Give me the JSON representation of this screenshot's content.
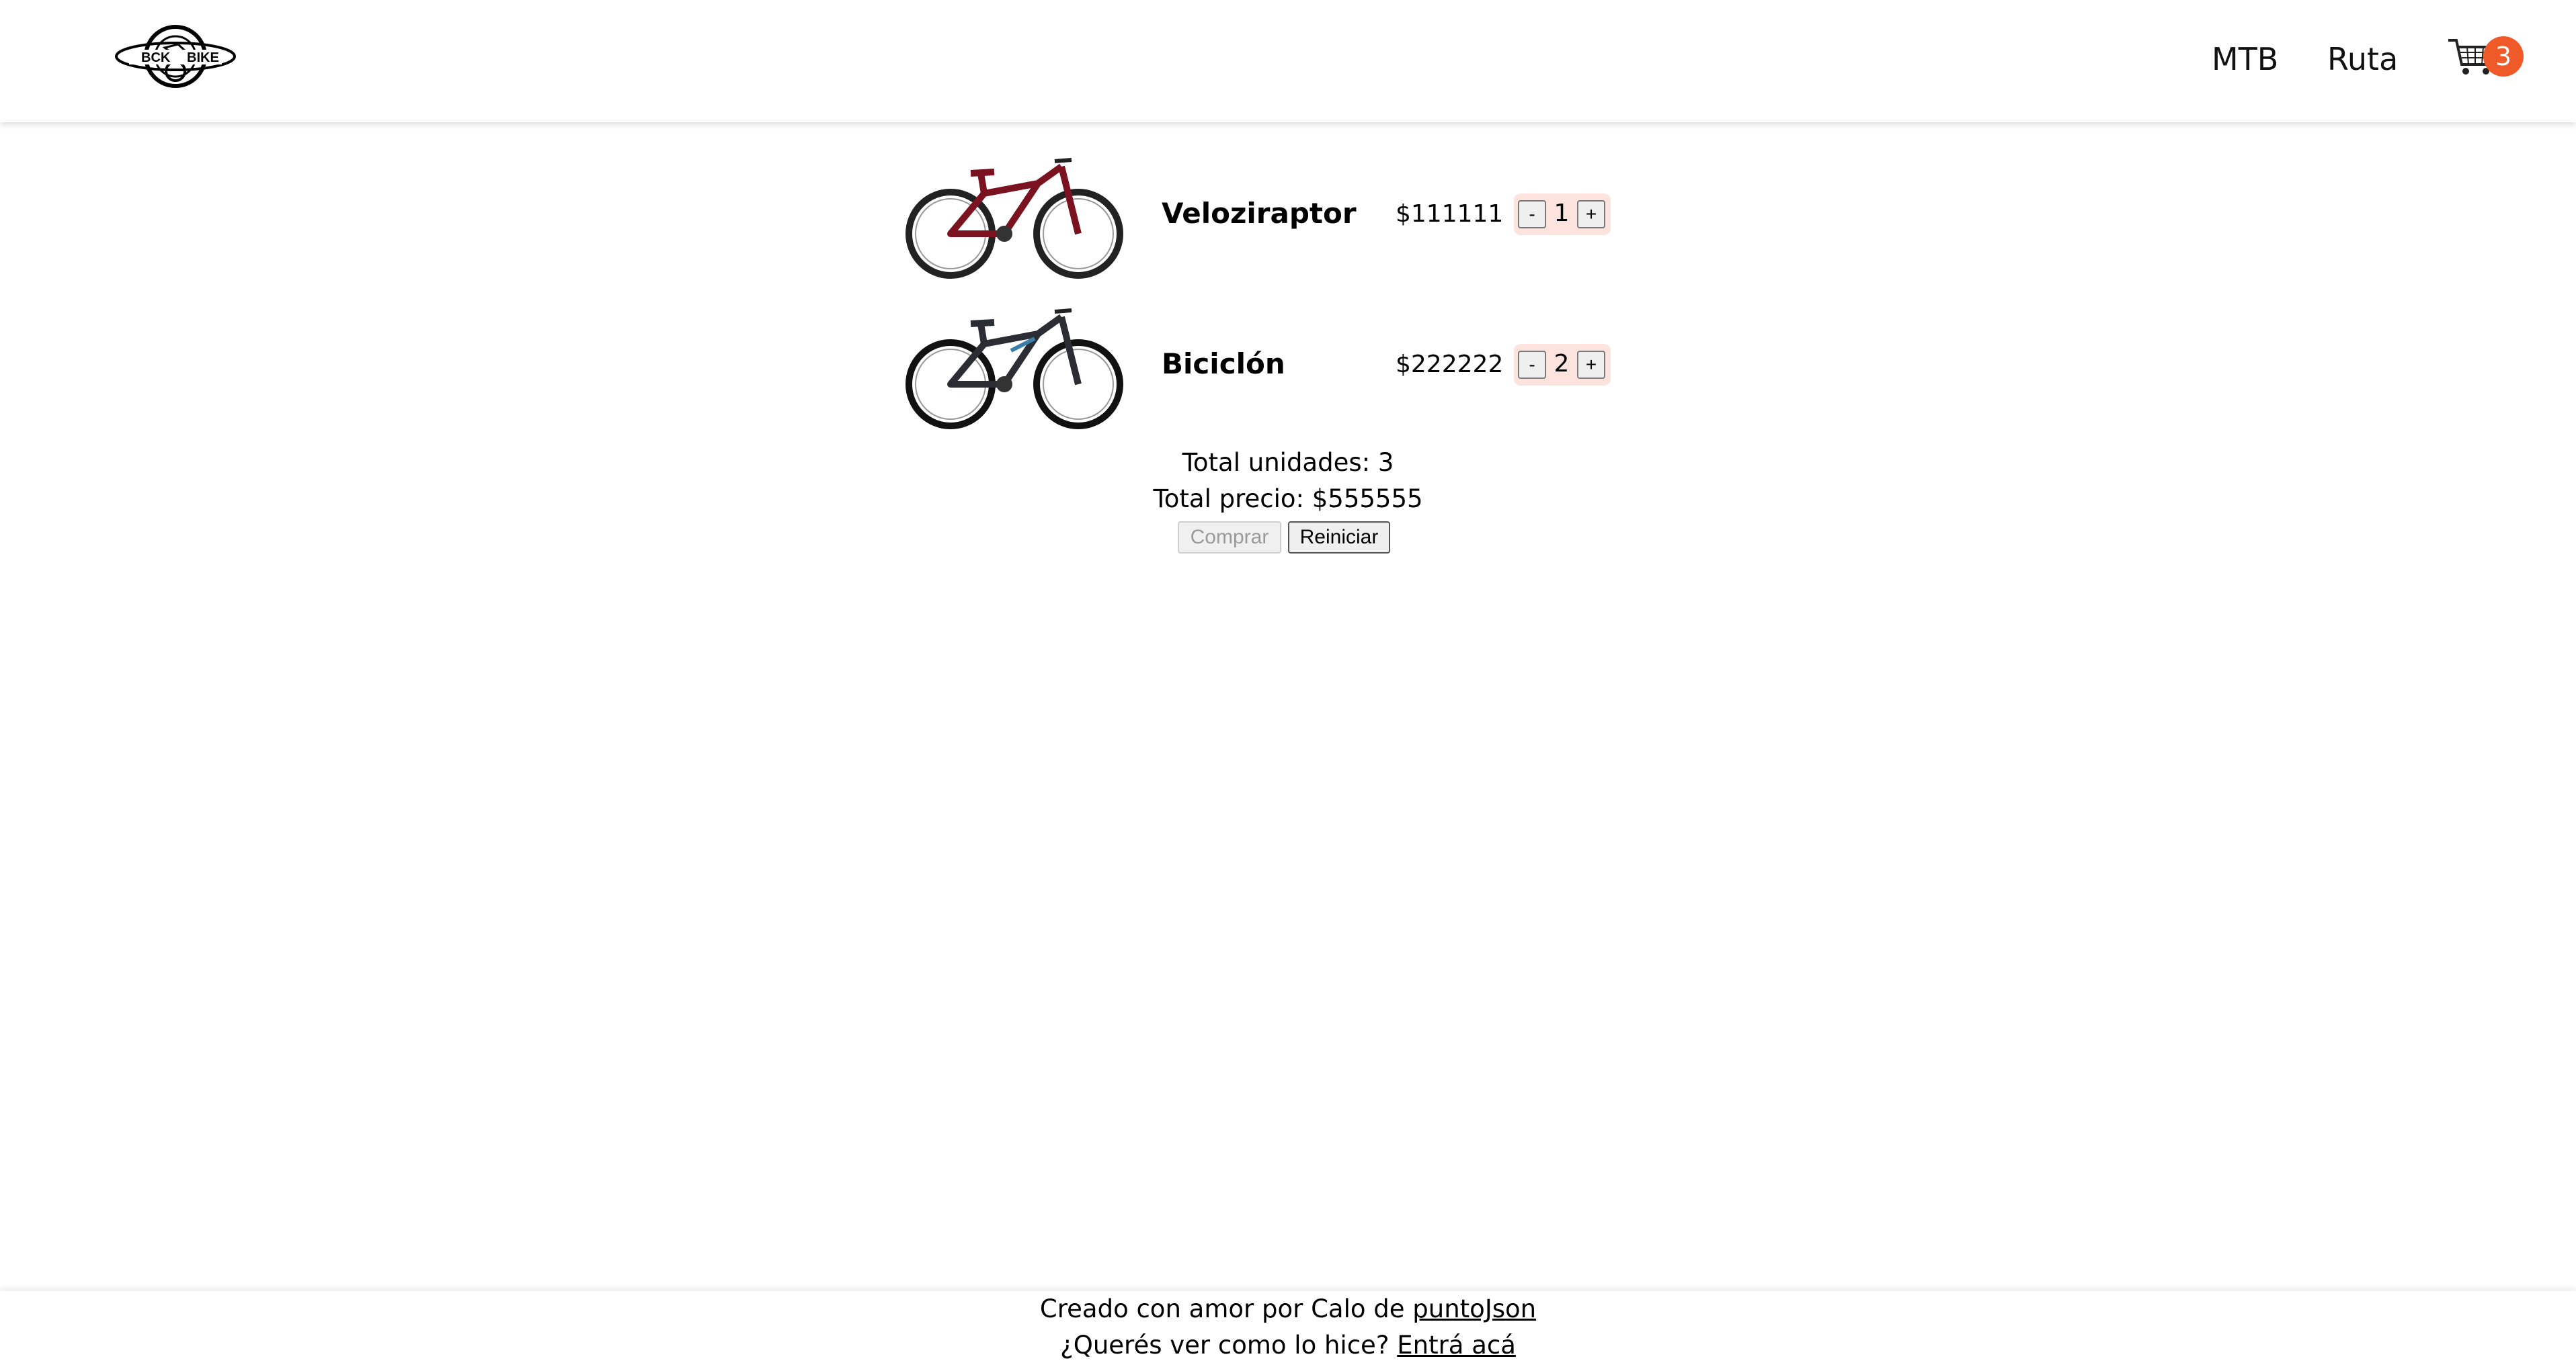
{
  "header": {
    "logo_text": "BCK BIKE",
    "nav": [
      {
        "label": "MTB"
      },
      {
        "label": "Ruta"
      }
    ],
    "cart_count": "3"
  },
  "cart": {
    "items": [
      {
        "name": "Veloziraptor",
        "price": "$111111",
        "quantity": "1",
        "frame_color": "#7a1220",
        "minus_label": "-",
        "plus_label": "+"
      },
      {
        "name": "Biciclón",
        "price": "$222222",
        "quantity": "2",
        "frame_color": "#2a2d33",
        "minus_label": "-",
        "plus_label": "+"
      }
    ],
    "total_units": "Total unidades: 3",
    "total_price": "Total precio: $555555",
    "buy_label": "Comprar",
    "reset_label": "Reiniciar"
  },
  "footer": {
    "line1_prefix": "Creado con amor por Calo de ",
    "line1_link": "puntoJson",
    "line2_prefix": "¿Querés ver como lo hice? ",
    "line2_link": "Entrá acá"
  },
  "colors": {
    "badge": "#f05a28",
    "qty_bg": "#fde3de"
  }
}
